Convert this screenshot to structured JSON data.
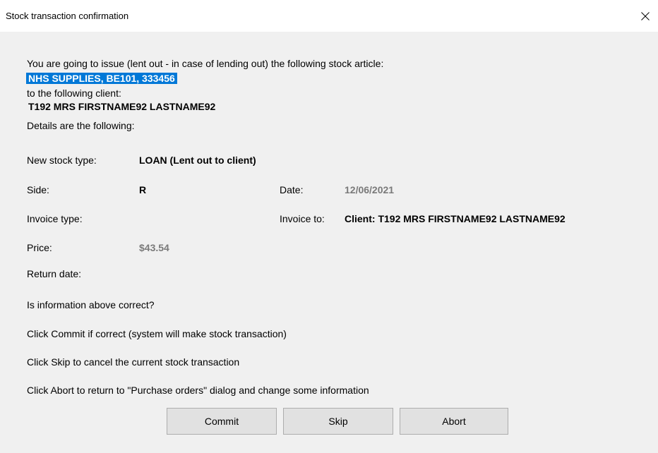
{
  "window": {
    "title": "Stock transaction confirmation"
  },
  "message": {
    "intro": "You are going to issue (lent out - in case of lending out) the following stock article:",
    "article": "NHS SUPPLIES, BE101, 333456",
    "to_client_label": "to the following client:",
    "client": "T192 MRS FIRSTNAME92 LASTNAME92",
    "details_label": "Details are the following:"
  },
  "details": {
    "stock_type_label": "New stock type:",
    "stock_type_value": "LOAN (Lent out to client)",
    "side_label": "Side:",
    "side_value": "R",
    "date_label": "Date:",
    "date_value": "12/06/2021",
    "invoice_type_label": "Invoice type:",
    "invoice_to_label": "Invoice to:",
    "invoice_to_value": "Client: T192 MRS FIRSTNAME92 LASTNAME92",
    "price_label": "Price:",
    "price_value": "$43.54",
    "return_date_label": "Return date:"
  },
  "instructions": {
    "question": "Is information above correct?",
    "commit_help": "Click Commit if correct (system will make stock transaction)",
    "skip_help": "Click Skip to cancel the current stock transaction",
    "abort_help": "Click Abort to return to \"Purchase orders\" dialog and change some information"
  },
  "buttons": {
    "commit": "Commit",
    "skip": "Skip",
    "abort": "Abort"
  },
  "colors": {
    "highlight": "#0078d7",
    "muted_text": "#7a7a7a"
  },
  "icons": {
    "close": "close-icon"
  }
}
